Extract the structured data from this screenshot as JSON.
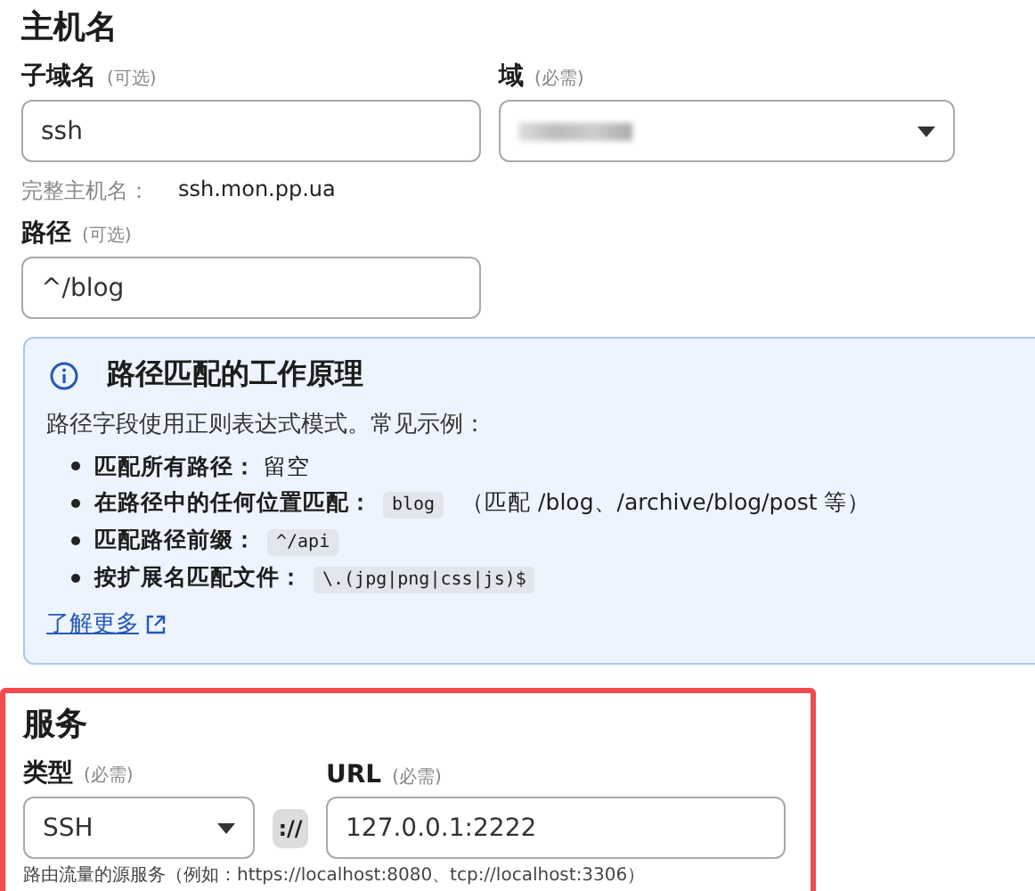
{
  "hostname": {
    "title": "主机名",
    "subdomain": {
      "label": "子域名",
      "hint": "(可选)",
      "value": "ssh"
    },
    "domain": {
      "label": "域",
      "hint": "(必需)",
      "redacted": true
    },
    "full_hostname": {
      "label": "完整主机名：",
      "value": "ssh.mon.pp.ua"
    },
    "path": {
      "label": "路径",
      "hint": "(可选)",
      "value": "^/blog"
    }
  },
  "info": {
    "title": "路径匹配的工作原理",
    "intro": "路径字段使用正则表达式模式。常见示例：",
    "examples": [
      {
        "label": "匹配所有路径：",
        "text": "留空"
      },
      {
        "label": "在路径中的任何位置匹配：",
        "code": "blog",
        "text": "（匹配 /blog、/archive/blog/post 等）"
      },
      {
        "label": "匹配路径前缀：",
        "code": "^/api"
      },
      {
        "label": "按扩展名匹配文件：",
        "code": "\\.(jpg|png|css|js)$"
      }
    ],
    "link": "了解更多"
  },
  "service": {
    "title": "服务",
    "type": {
      "label": "类型",
      "hint": "(必需)",
      "value": "SSH"
    },
    "separator": "://",
    "url": {
      "label": "URL",
      "hint": "(必需)",
      "value": "127.0.0.1:2222"
    },
    "help": "路由流量的源服务（例如：https://localhost:8080、tcp://localhost:3306）"
  }
}
